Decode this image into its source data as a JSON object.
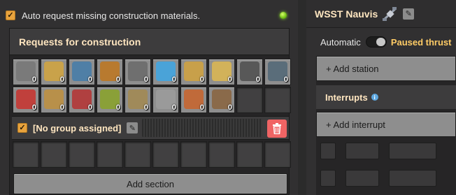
{
  "logistics": {
    "auto_request_label": "Auto request missing construction materials.",
    "auto_request_checked": true,
    "status_color": "#6fbf13",
    "requests_title": "Requests for construction",
    "items": [
      {
        "icon": "transport-belt-icon",
        "color": "#7a7a7a",
        "count": "0"
      },
      {
        "icon": "inserter-icon",
        "color": "#c9a24a",
        "count": "0"
      },
      {
        "icon": "solar-panel-icon",
        "color": "#4f7fa6",
        "count": "0"
      },
      {
        "icon": "roboport-icon",
        "color": "#b87a2f",
        "count": "0"
      },
      {
        "icon": "assembler-icon",
        "color": "#6f6f6f",
        "count": "0"
      },
      {
        "icon": "fast-inserter-icon",
        "color": "#4aa3d8",
        "count": "0"
      },
      {
        "icon": "splitter-icon",
        "color": "#c8a04a",
        "count": "0"
      },
      {
        "icon": "underground-belt-icon",
        "color": "#d2b25a",
        "count": "0"
      },
      {
        "icon": "chemical-plant-icon",
        "color": "#585858",
        "count": "0"
      },
      {
        "icon": "pump-icon",
        "color": "#5a6d7a",
        "count": "0"
      },
      {
        "icon": "red-inserter-icon",
        "color": "#c0403c",
        "count": "0"
      },
      {
        "icon": "wooden-chest-icon",
        "color": "#b8904a",
        "count": "0"
      },
      {
        "icon": "red-belt-icon",
        "color": "#b04040",
        "count": "0"
      },
      {
        "icon": "furnace-icon",
        "color": "#8aa038",
        "count": "0"
      },
      {
        "icon": "gun-turret-icon",
        "color": "#a08a5a",
        "count": "0"
      },
      {
        "icon": "big-pole-icon",
        "color": "#9a9a9a",
        "count": "0"
      },
      {
        "icon": "medium-pole-icon",
        "color": "#c06a3a",
        "count": "0"
      },
      {
        "icon": "small-pole-icon",
        "color": "#8a6a4a",
        "count": "0"
      }
    ],
    "group_label": "[No group assigned]",
    "group_checked": true,
    "add_section_label": "Add section"
  },
  "schedule": {
    "title": "WSST Nauvis",
    "mode_auto_label": "Automatic",
    "mode_state_label": "Paused thrust",
    "add_station_label": "+ Add station",
    "interrupts_label": "Interrupts",
    "info_glyph": "i",
    "add_interrupt_label": "+ Add interrupt"
  }
}
